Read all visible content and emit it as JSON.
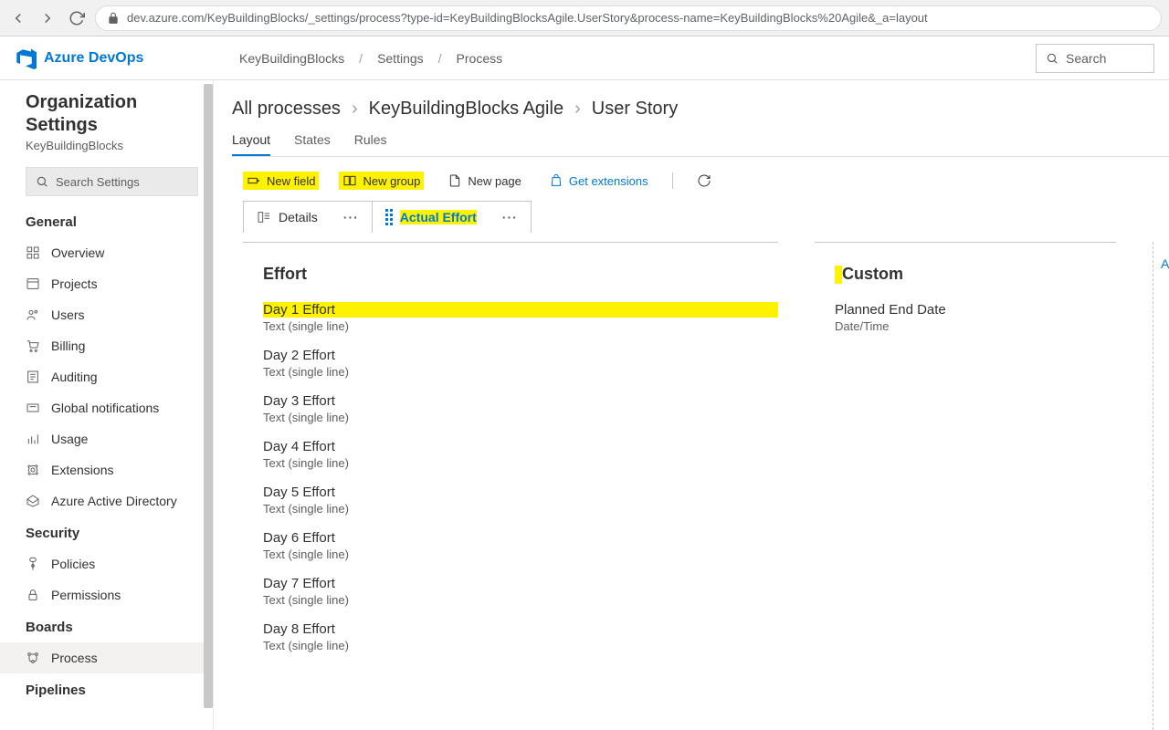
{
  "browser": {
    "url": "dev.azure.com/KeyBuildingBlocks/_settings/process?type-id=KeyBuildingBlocksAgile.UserStory&process-name=KeyBuildingBlocks%20Agile&_a=layout"
  },
  "header": {
    "product": "Azure DevOps",
    "breadcrumbs": [
      "KeyBuildingBlocks",
      "Settings",
      "Process"
    ],
    "search_placeholder": "Search"
  },
  "sidebar": {
    "title_line1": "Organization",
    "title_line2": "Settings",
    "org": "KeyBuildingBlocks",
    "search_placeholder": "Search Settings",
    "sections": {
      "general": {
        "label": "General",
        "items": [
          "Overview",
          "Projects",
          "Users",
          "Billing",
          "Auditing",
          "Global notifications",
          "Usage",
          "Extensions",
          "Azure Active Directory"
        ]
      },
      "security": {
        "label": "Security",
        "items": [
          "Policies",
          "Permissions"
        ]
      },
      "boards": {
        "label": "Boards",
        "items": [
          "Process"
        ]
      },
      "pipelines": {
        "label": "Pipelines"
      }
    }
  },
  "main": {
    "crumbs": [
      "All processes",
      "KeyBuildingBlocks Agile",
      "User Story"
    ],
    "tabs": [
      "Layout",
      "States",
      "Rules"
    ],
    "toolbar": {
      "new_field": "New field",
      "new_group": "New group",
      "new_page": "New page",
      "get_extensions": "Get extensions"
    },
    "page_tabs": {
      "details": "Details",
      "actual_effort": "Actual Effort"
    },
    "groups": {
      "effort": {
        "title": "Effort",
        "fields": [
          {
            "name": "Day 1 Effort",
            "type": "Text (single line)"
          },
          {
            "name": "Day 2 Effort",
            "type": "Text (single line)"
          },
          {
            "name": "Day 3 Effort",
            "type": "Text (single line)"
          },
          {
            "name": "Day 4 Effort",
            "type": "Text (single line)"
          },
          {
            "name": "Day 5 Effort",
            "type": "Text (single line)"
          },
          {
            "name": "Day 6 Effort",
            "type": "Text (single line)"
          },
          {
            "name": "Day 7 Effort",
            "type": "Text (single line)"
          },
          {
            "name": "Day 8 Effort",
            "type": "Text (single line)"
          }
        ]
      },
      "custom": {
        "title": "Custom",
        "fields": [
          {
            "name": "Planned End Date",
            "type": "Date/Time"
          }
        ]
      }
    },
    "extra_letter": "A"
  }
}
